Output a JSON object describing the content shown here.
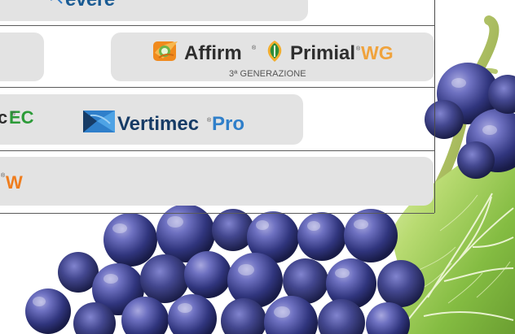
{
  "top_row": {
    "brand_text": "evere"
  },
  "row_2": {
    "brand_left": "Affirm",
    "brand_middle": "Primial",
    "brand_right": "WG",
    "subtitle": "3ª GENERAZIONE"
  },
  "row_3": {
    "left_fragment": "c",
    "left_suffix": "EC",
    "center_brand": "Vertimec",
    "center_suffix": "Pro"
  },
  "row_4": {
    "left_suffix": "W"
  },
  "marks": {
    "registered": "®"
  },
  "colors": {
    "affirm_orange": "#f08a1d",
    "primial_green": "#2d8d3a",
    "wg_orange": "#f0a33d",
    "ec_green": "#2c9b38",
    "vertimec_navy": "#163b66",
    "pro_blue": "#2f7fca"
  },
  "icons": {
    "affirm_logo": "affirm-logo-icon",
    "primial_logo": "primial-logo-icon",
    "vertimec_logo": "vertimec-logo-icon",
    "top_logo": "top-logo-icon"
  }
}
